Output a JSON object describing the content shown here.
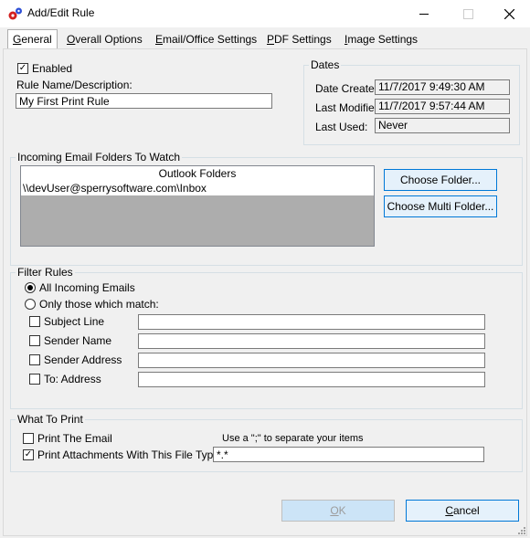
{
  "window": {
    "title": "Add/Edit Rule",
    "minimize_icon": "minimize-icon",
    "maximize_icon": "maximize-icon",
    "close_icon": "close-icon"
  },
  "tabs": [
    {
      "label": "General",
      "mnemonic": "G",
      "rest": "eneral",
      "active": true
    },
    {
      "label": "Overall Options",
      "mnemonic": "O",
      "rest": "verall Options"
    },
    {
      "label": "Email/Office Settings",
      "mnemonic": "E",
      "rest": "mail/Office Settings"
    },
    {
      "label": "PDF Settings",
      "mnemonic": "P",
      "rest": "DF Settings"
    },
    {
      "label": "Image Settings",
      "mnemonic": "I",
      "rest": "mage Settings"
    }
  ],
  "general": {
    "enabled_label": "Enabled",
    "enabled_checked": true,
    "rule_name_label": "Rule Name/Description:",
    "rule_name_value": "My First Print Rule"
  },
  "dates": {
    "group_title": "Dates",
    "date_created_label": "Date Created:",
    "date_created_value": "11/7/2017 9:49:30 AM",
    "last_modified_label": "Last Modified:",
    "last_modified_value": "11/7/2017 9:57:44 AM",
    "last_used_label": "Last Used:",
    "last_used_value": "Never"
  },
  "folders": {
    "group_title": "Incoming Email Folders To Watch",
    "list_header": "Outlook Folders",
    "items": [
      "\\\\devUser@sperrysoftware.com\\Inbox"
    ],
    "choose_folder_button": "Choose Folder...",
    "choose_multi_folder_button": "Choose Multi Folder..."
  },
  "filter": {
    "group_title": "Filter Rules",
    "all_label": "All Incoming Emails",
    "all_selected": true,
    "only_label": "Only those which match:",
    "fields": [
      {
        "label": "Subject Line",
        "value": ""
      },
      {
        "label": "Sender Name",
        "value": ""
      },
      {
        "label": "Sender Address",
        "value": ""
      },
      {
        "label": "To: Address",
        "value": ""
      }
    ]
  },
  "print": {
    "group_title": "What To Print",
    "print_email_label": "Print The Email",
    "print_email_checked": false,
    "separator_hint": "Use a \";\" to separate your items",
    "print_attachments_label": "Print Attachments With This File Type:",
    "print_attachments_checked": true,
    "file_type_value": "*.*"
  },
  "buttons": {
    "ok_mnemonic": "O",
    "ok_rest": "K",
    "cancel_mnemonic": "C",
    "cancel_rest": "ancel"
  }
}
